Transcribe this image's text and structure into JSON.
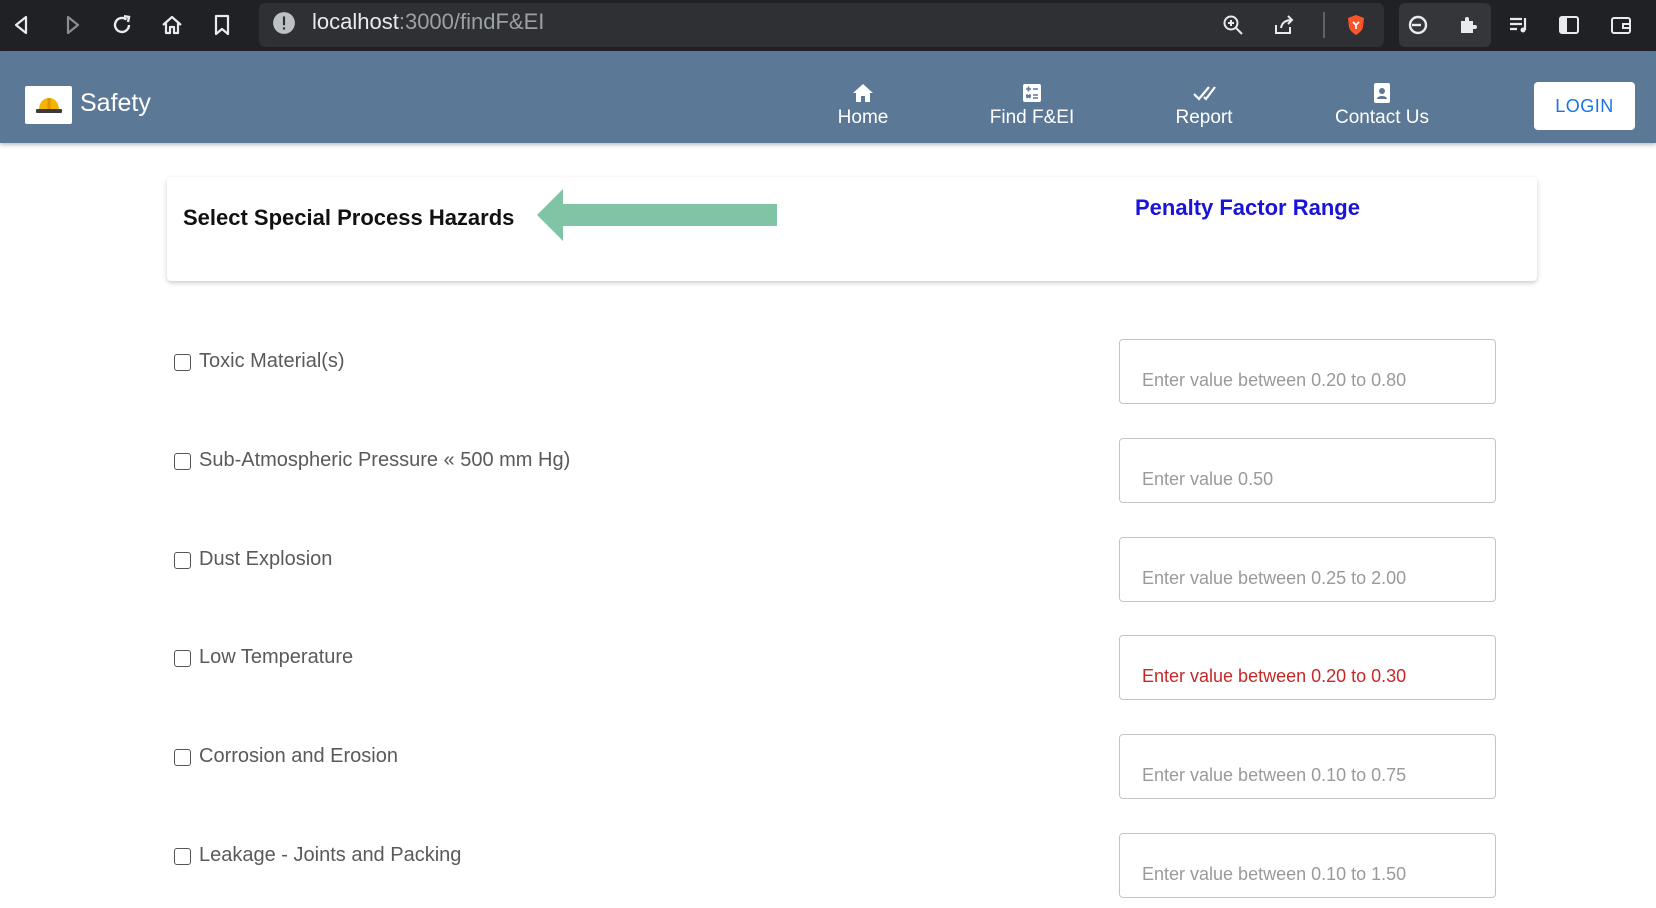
{
  "browser": {
    "url_host": "localhost",
    "url_path": ":3000/findF&EI"
  },
  "header": {
    "brand": "Safety",
    "nav": [
      {
        "label": "Home",
        "icon": "home-icon"
      },
      {
        "label": "Find F&EI",
        "icon": "calculator-icon"
      },
      {
        "label": "Report",
        "icon": "double-check-icon"
      },
      {
        "label": "Contact Us",
        "icon": "contact-card-icon"
      }
    ],
    "login_label": "LOGIN"
  },
  "main": {
    "section_title": "Select Special Process Hazards",
    "range_title": "Penalty Factor Range",
    "hazards": [
      {
        "label": "Toxic Material(s)",
        "placeholder": "Enter value between 0.20 to 0.80",
        "checked": false
      },
      {
        "label": "Sub-Atmospheric Pressure « 500 mm Hg)",
        "placeholder": "Enter value 0.50",
        "checked": false
      },
      {
        "label": "Dust Explosion",
        "placeholder": "Enter value between 0.25 to 2.00",
        "checked": false
      },
      {
        "label": "Low Temperature",
        "placeholder": "Enter value between 0.20 to 0.30",
        "checked": false
      },
      {
        "label": "Corrosion and Erosion",
        "placeholder": "Enter value between 0.10 to 0.75",
        "checked": false
      },
      {
        "label": "Leakage - Joints and Packing",
        "placeholder": "Enter value between 0.10 to 1.50",
        "checked": false
      }
    ]
  },
  "colors": {
    "appbar": "#5b7896",
    "range_title": "#1a13d8",
    "arrow": "#7fc4a4",
    "warning_placeholder": "#c62828",
    "login_text": "#1a73e8"
  }
}
